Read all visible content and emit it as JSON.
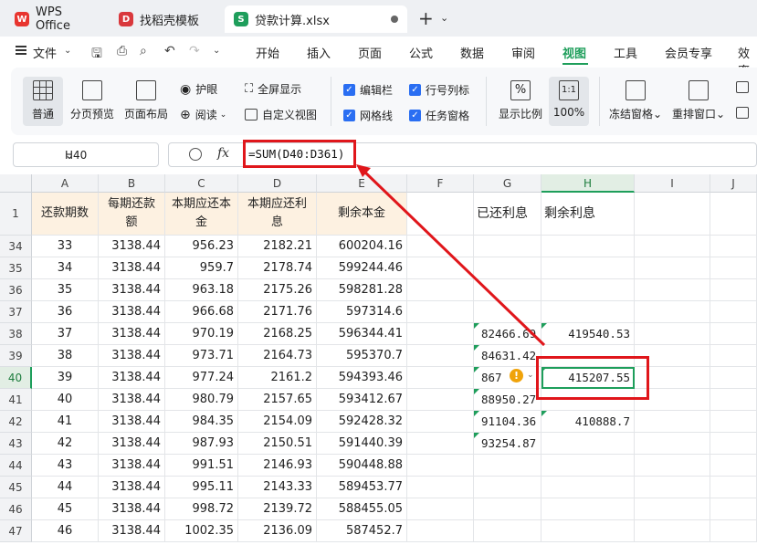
{
  "tabs": [
    {
      "label": "WPS Office",
      "icon": "W"
    },
    {
      "label": "找稻壳模板",
      "icon": "D"
    },
    {
      "label": "贷款计算.xlsx",
      "icon": "S"
    }
  ],
  "menu": {
    "file": "文件",
    "items": [
      "开始",
      "插入",
      "页面",
      "公式",
      "数据",
      "审阅",
      "视图",
      "工具",
      "会员专享",
      "效率"
    ],
    "active": "视图"
  },
  "ribbon": {
    "normal": "普通",
    "page_break": "分页预览",
    "page_layout": "页面布局",
    "eye_care": "护眼",
    "reading": "阅读",
    "fullscreen": "全屏显示",
    "custom_view": "自定义视图",
    "formula_bar": "编辑栏",
    "gridlines": "网格线",
    "headings": "行号列标",
    "task_pane": "任务窗格",
    "zoom_ratio": "显示比例",
    "zoom_100": "100%",
    "freeze": "冻结窗格",
    "rearrange": "重排窗口"
  },
  "formula_bar": {
    "cell_ref": "H40",
    "fx": "fx",
    "formula": "=SUM(D40:D361)"
  },
  "columns": [
    "A",
    "B",
    "C",
    "D",
    "E",
    "F",
    "G",
    "H",
    "I",
    "J"
  ],
  "header_row": {
    "row_num": "1",
    "A": "还款期数",
    "B": "每期还款额",
    "C": "本期应还本金",
    "D": "本期应还利息",
    "E": "剩余本金",
    "G": "已还利息",
    "H": "剩余利息"
  },
  "rows": [
    {
      "n": "34",
      "A": "33",
      "B": "3138.44",
      "C": "956.23",
      "D": "2182.21",
      "E": "600204.16",
      "G": "",
      "H": ""
    },
    {
      "n": "35",
      "A": "34",
      "B": "3138.44",
      "C": "959.7",
      "D": "2178.74",
      "E": "599244.46",
      "G": "",
      "H": ""
    },
    {
      "n": "36",
      "A": "35",
      "B": "3138.44",
      "C": "963.18",
      "D": "2175.26",
      "E": "598281.28",
      "G": "",
      "H": ""
    },
    {
      "n": "37",
      "A": "36",
      "B": "3138.44",
      "C": "966.68",
      "D": "2171.76",
      "E": "597314.6",
      "G": "",
      "H": ""
    },
    {
      "n": "38",
      "A": "37",
      "B": "3138.44",
      "C": "970.19",
      "D": "2168.25",
      "E": "596344.41",
      "G": "82466.69",
      "H": "419540.53"
    },
    {
      "n": "39",
      "A": "38",
      "B": "3138.44",
      "C": "973.71",
      "D": "2164.73",
      "E": "595370.7",
      "G": "84631.42",
      "H": ""
    },
    {
      "n": "40",
      "A": "39",
      "B": "3138.44",
      "C": "977.24",
      "D": "2161.2",
      "E": "594393.46",
      "G": "867",
      "H": "415207.55"
    },
    {
      "n": "41",
      "A": "40",
      "B": "3138.44",
      "C": "980.79",
      "D": "2157.65",
      "E": "593412.67",
      "G": "88950.27",
      "H": ""
    },
    {
      "n": "42",
      "A": "41",
      "B": "3138.44",
      "C": "984.35",
      "D": "2154.09",
      "E": "592428.32",
      "G": "91104.36",
      "H": "410888.7"
    },
    {
      "n": "43",
      "A": "42",
      "B": "3138.44",
      "C": "987.93",
      "D": "2150.51",
      "E": "591440.39",
      "G": "93254.87",
      "H": ""
    },
    {
      "n": "44",
      "A": "43",
      "B": "3138.44",
      "C": "991.51",
      "D": "2146.93",
      "E": "590448.88",
      "G": "",
      "H": ""
    },
    {
      "n": "45",
      "A": "44",
      "B": "3138.44",
      "C": "995.11",
      "D": "2143.33",
      "E": "589453.77",
      "G": "",
      "H": ""
    },
    {
      "n": "46",
      "A": "45",
      "B": "3138.44",
      "C": "998.72",
      "D": "2139.72",
      "E": "588455.05",
      "G": "",
      "H": ""
    },
    {
      "n": "47",
      "A": "46",
      "B": "3138.44",
      "C": "1002.35",
      "D": "2136.09",
      "E": "587452.7",
      "G": "",
      "H": ""
    }
  ],
  "colors": {
    "accent": "#1e9e5b",
    "annotation": "#e0161b",
    "header_fill": "#fdf1e1"
  }
}
